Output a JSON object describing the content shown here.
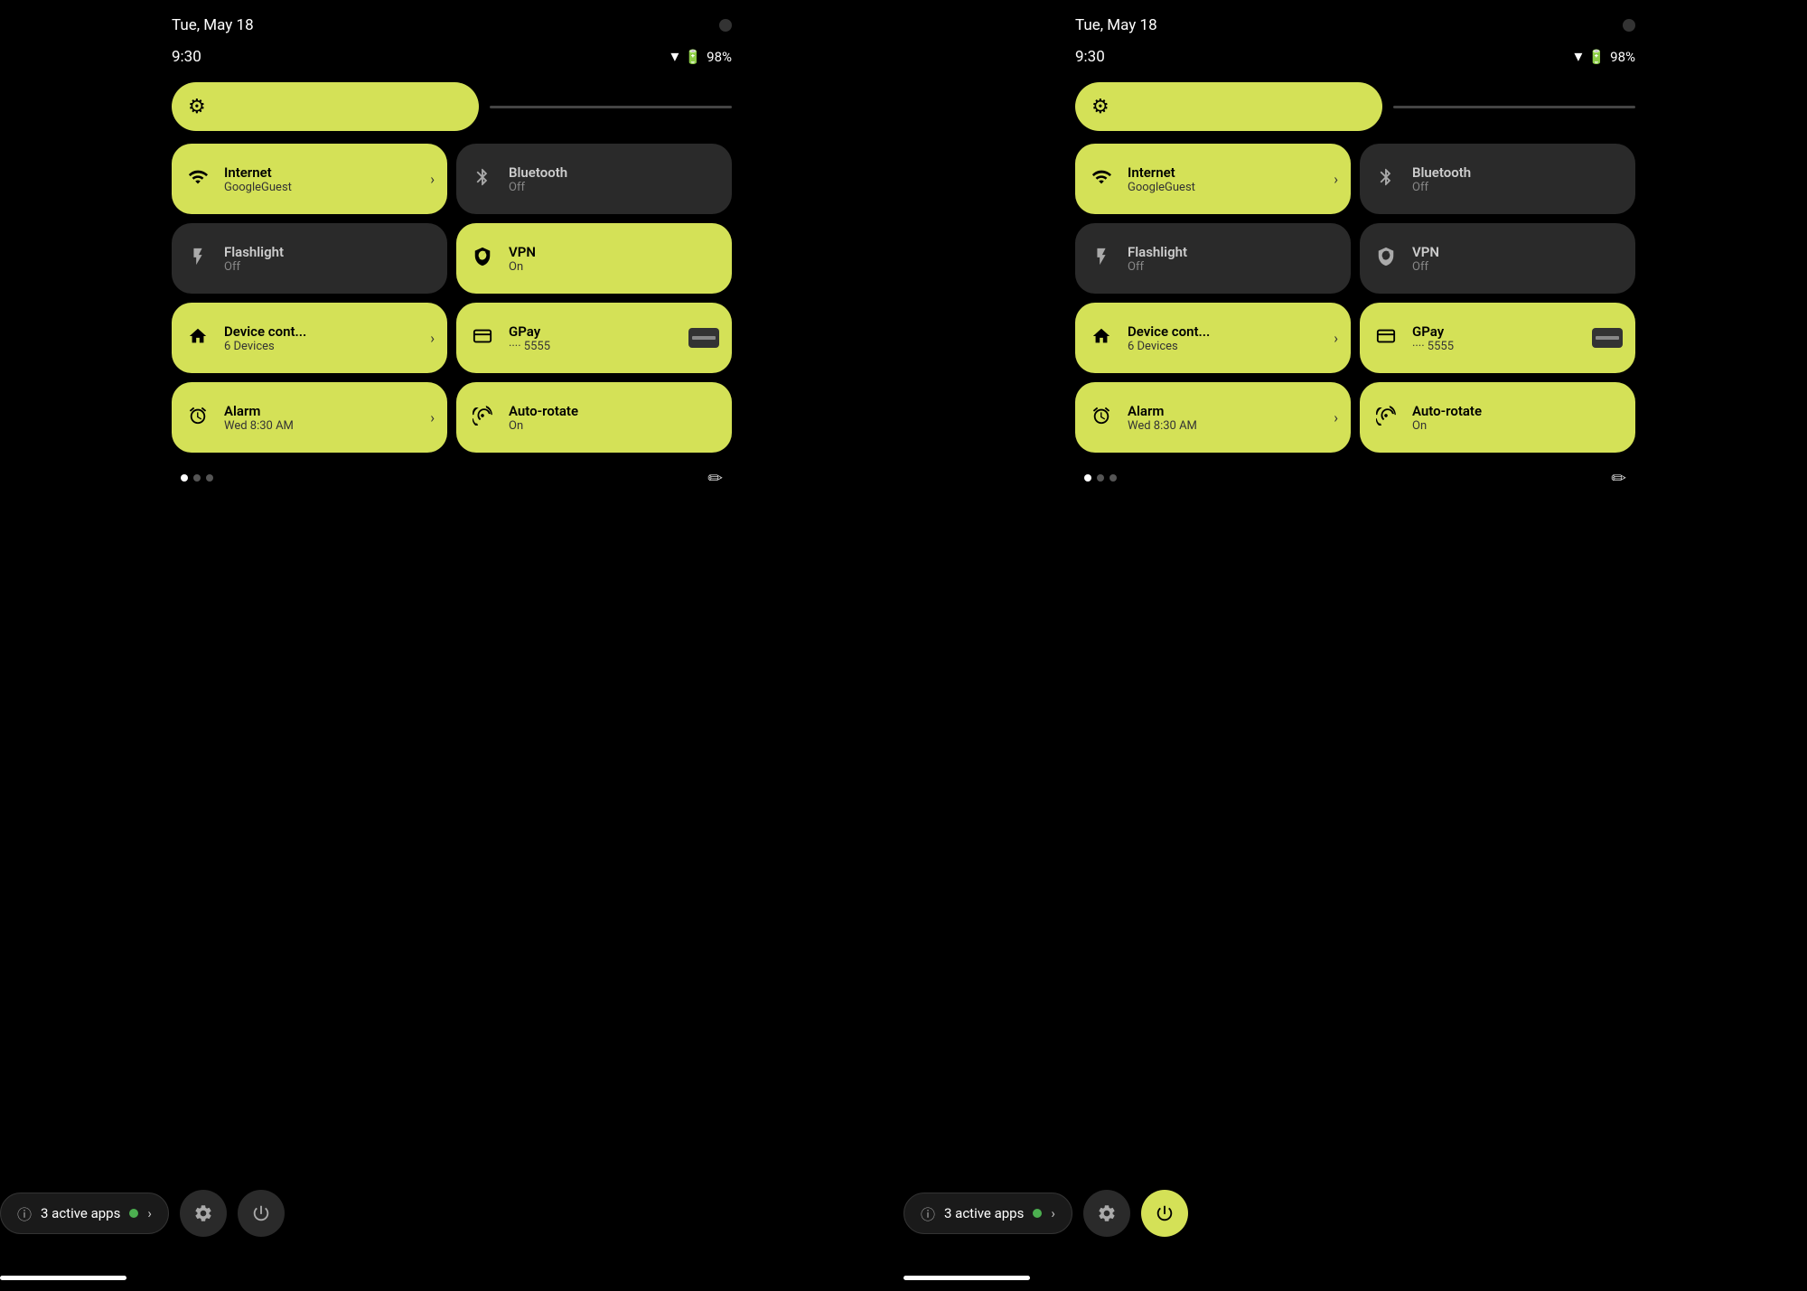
{
  "panels": [
    {
      "id": "left",
      "status": {
        "date": "Tue, May 18",
        "time": "9:30",
        "battery": "98%"
      },
      "brightness": {
        "icon": "⚙"
      },
      "tiles": [
        {
          "id": "internet",
          "label": "Internet",
          "sublabel": "GoogleGuest",
          "icon": "wifi",
          "active": true,
          "hasArrow": true
        },
        {
          "id": "bluetooth",
          "label": "Bluetooth",
          "sublabel": "Off",
          "icon": "bluetooth",
          "active": false,
          "hasArrow": false
        },
        {
          "id": "flashlight",
          "label": "Flashlight",
          "sublabel": "Off",
          "icon": "flashlight",
          "active": false,
          "hasArrow": false
        },
        {
          "id": "vpn",
          "label": "VPN",
          "sublabel": "On",
          "icon": "vpn",
          "active": true,
          "hasArrow": false
        },
        {
          "id": "device",
          "label": "Device cont...",
          "sublabel": "6 Devices",
          "icon": "device",
          "active": true,
          "hasArrow": true
        },
        {
          "id": "gpay",
          "label": "GPay",
          "sublabel": "···· 5555",
          "icon": "gpay",
          "active": true,
          "hasArrow": false,
          "isGpay": true
        },
        {
          "id": "alarm",
          "label": "Alarm",
          "sublabel": "Wed 8:30 AM",
          "icon": "alarm",
          "active": true,
          "hasArrow": true
        },
        {
          "id": "autorotate",
          "label": "Auto-rotate",
          "sublabel": "On",
          "icon": "rotate",
          "active": true,
          "hasArrow": false
        }
      ],
      "activeApps": {
        "label": "3 active apps"
      },
      "powerBtnActive": false
    },
    {
      "id": "right",
      "status": {
        "date": "Tue, May 18",
        "time": "9:30",
        "battery": "98%"
      },
      "brightness": {
        "icon": "⚙"
      },
      "tiles": [
        {
          "id": "internet",
          "label": "Internet",
          "sublabel": "GoogleGuest",
          "icon": "wifi",
          "active": true,
          "hasArrow": true
        },
        {
          "id": "bluetooth",
          "label": "Bluetooth",
          "sublabel": "Off",
          "icon": "bluetooth",
          "active": false,
          "hasArrow": false
        },
        {
          "id": "flashlight",
          "label": "Flashlight",
          "sublabel": "Off",
          "icon": "flashlight",
          "active": false,
          "hasArrow": false
        },
        {
          "id": "vpn",
          "label": "VPN",
          "sublabel": "Off",
          "icon": "vpn",
          "active": false,
          "hasArrow": false
        },
        {
          "id": "device",
          "label": "Device cont...",
          "sublabel": "6 Devices",
          "icon": "device",
          "active": true,
          "hasArrow": true
        },
        {
          "id": "gpay",
          "label": "GPay",
          "sublabel": "···· 5555",
          "icon": "gpay",
          "active": true,
          "hasArrow": false,
          "isGpay": true
        },
        {
          "id": "alarm",
          "label": "Alarm",
          "sublabel": "Wed 8:30 AM",
          "icon": "alarm",
          "active": true,
          "hasArrow": true
        },
        {
          "id": "autorotate",
          "label": "Auto-rotate",
          "sublabel": "On",
          "icon": "rotate",
          "active": true,
          "hasArrow": false
        }
      ],
      "activeApps": {
        "label": "3 active apps"
      },
      "powerBtnActive": true
    }
  ]
}
